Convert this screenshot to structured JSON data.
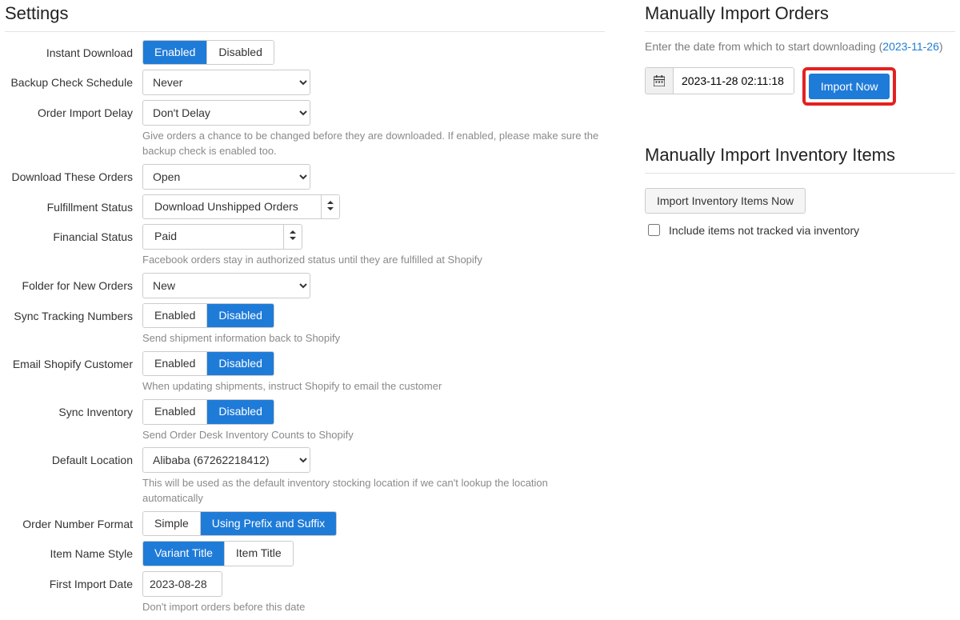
{
  "settings": {
    "title": "Settings",
    "instant_download": {
      "label": "Instant Download",
      "enabled": "Enabled",
      "disabled": "Disabled",
      "active": "enabled"
    },
    "backup_check": {
      "label": "Backup Check Schedule",
      "value": "Never"
    },
    "import_delay": {
      "label": "Order Import Delay",
      "value": "Don't Delay",
      "help": "Give orders a chance to be changed before they are downloaded. If enabled, please make sure the backup check is enabled too."
    },
    "download_orders": {
      "label": "Download These Orders",
      "value": "Open"
    },
    "fulfillment_status": {
      "label": "Fulfillment Status",
      "value": "Download Unshipped Orders"
    },
    "financial_status": {
      "label": "Financial Status",
      "value": "Paid",
      "help": "Facebook orders stay in authorized status until they are fulfilled at Shopify"
    },
    "folder_new": {
      "label": "Folder for New Orders",
      "value": "New"
    },
    "sync_tracking": {
      "label": "Sync Tracking Numbers",
      "enabled": "Enabled",
      "disabled": "Disabled",
      "active": "disabled",
      "help": "Send shipment information back to Shopify"
    },
    "email_customer": {
      "label": "Email Shopify Customer",
      "enabled": "Enabled",
      "disabled": "Disabled",
      "active": "disabled",
      "help": "When updating shipments, instruct Shopify to email the customer"
    },
    "sync_inventory": {
      "label": "Sync Inventory",
      "enabled": "Enabled",
      "disabled": "Disabled",
      "active": "disabled",
      "help": "Send Order Desk Inventory Counts to Shopify"
    },
    "default_location": {
      "label": "Default Location",
      "value": "Alibaba (67262218412)",
      "help": "This will be used as the default inventory stocking location if we can't lookup the location automatically"
    },
    "order_number_format": {
      "label": "Order Number Format",
      "simple": "Simple",
      "prefix": "Using Prefix and Suffix"
    },
    "item_name_style": {
      "label": "Item Name Style",
      "variant": "Variant Title",
      "item": "Item Title"
    },
    "first_import_date": {
      "label": "First Import Date",
      "value": "2023-08-28",
      "help": "Don't import orders before this date"
    }
  },
  "manual_orders": {
    "title": "Manually Import Orders",
    "hint_prefix": "Enter the date from which to start downloading (",
    "hint_link": "2023-11-26",
    "hint_suffix": ")",
    "datetime": "2023-11-28 02:11:18",
    "import_button": "Import Now"
  },
  "manual_inventory": {
    "title": "Manually Import Inventory Items",
    "button": "Import Inventory Items Now",
    "checkbox_label": "Include items not tracked via inventory"
  }
}
